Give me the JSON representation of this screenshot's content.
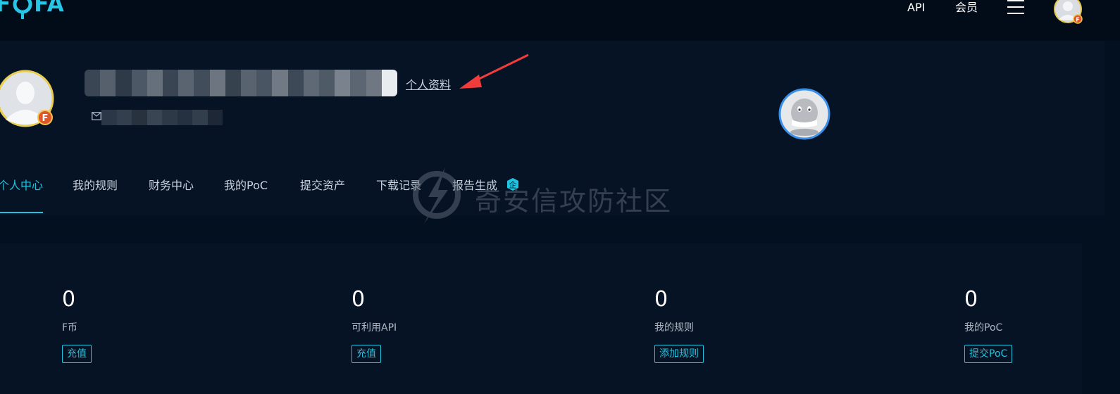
{
  "header": {
    "logo_text": "FOFA",
    "nav": [
      "API",
      "会员"
    ],
    "menu_icon": "hamburger-icon",
    "avatar_icon": "user-avatar-icon"
  },
  "profile": {
    "profile_link": "个人资料",
    "email_icon": "mail-icon",
    "annotation": "red-arrow"
  },
  "tabs": [
    {
      "label": "个人中心",
      "active": true
    },
    {
      "label": "我的规则"
    },
    {
      "label": "财务中心"
    },
    {
      "label": "我的PoC"
    },
    {
      "label": "提交资产"
    },
    {
      "label": "下载记录"
    },
    {
      "label": "报告生成",
      "badge": "企"
    }
  ],
  "watermark": "奇安信攻防社区",
  "stats": [
    {
      "value": "0",
      "label": "F币",
      "button": "充值"
    },
    {
      "value": "0",
      "label": "可利用API",
      "button": "充值"
    },
    {
      "value": "0",
      "label": "我的规则",
      "button": "添加规则"
    },
    {
      "value": "0",
      "label": "我的PoC",
      "button": "提交PoC"
    }
  ],
  "colors": {
    "accent": "#1fc4e0",
    "background": "#03101f",
    "panel": "#061325",
    "annotation": "#f23b3b"
  }
}
